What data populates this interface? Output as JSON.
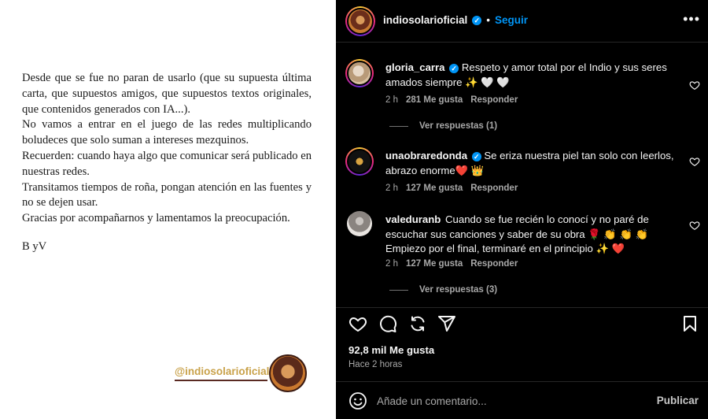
{
  "post_image": {
    "letter": [
      "Desde que se fue no paran de usarlo (que su supuesta última carta, que supuestos amigos, que supuestos textos originales, que contenidos generados con IA...).",
      "No vamos a entrar en el juego de las redes multiplicando boludeces que solo suman a intereses mezquinos.",
      "Recuerden: cuando haya algo que comunicar será publicado en nuestras redes.",
      "Transitamos tiempos de roña, pongan atención en las fuentes y no se dejen usar.",
      "Gracias por acompañarnos y lamentamos la preocupación."
    ],
    "signature": "B yV",
    "watermark_handle": "@indiosolarioficial"
  },
  "header": {
    "username": "indiosolarioficial",
    "separator": "•",
    "follow_label": "Seguir",
    "more_label": "•••"
  },
  "comments": [
    {
      "username": "gloria_carra",
      "verified": true,
      "text": "Respeto y amor total por el Indio y sus seres amados siempre ✨ 🤍 🤍",
      "time": "2 h",
      "likes": "281 Me gusta",
      "reply": "Responder",
      "view_replies": "Ver respuestas (1)"
    },
    {
      "username": "unaobraredonda",
      "verified": true,
      "text": "Se eriza nuestra piel tan solo con leerlos, abrazo enorme❤️ 👑",
      "time": "2 h",
      "likes": "127 Me gusta",
      "reply": "Responder"
    },
    {
      "username": "valeduranb",
      "verified": false,
      "text": "Cuando se fue recién lo conocí y no paré de escuchar sus canciones y saber de su obra 🌹 👏 👏 👏 Empiezo por el final, terminaré en el principio ✨ ❤️",
      "time": "2 h",
      "likes": "127 Me gusta",
      "reply": "Responder",
      "view_replies": "Ver respuestas (3)"
    }
  ],
  "actions": {
    "icons": [
      "heart-icon",
      "comment-icon",
      "share-icon",
      "send-icon",
      "bookmark-icon"
    ]
  },
  "stats": {
    "likes": "92,8 mil Me gusta",
    "time_ago": "Hace 2 horas"
  },
  "add_comment": {
    "placeholder": "Añade un comentario...",
    "publish_label": "Publicar"
  },
  "colors": {
    "background": "#000000",
    "text": "#f5f5f5",
    "muted": "#a8a8a8",
    "link": "#0095f6",
    "watermark": "#c9a24a"
  }
}
